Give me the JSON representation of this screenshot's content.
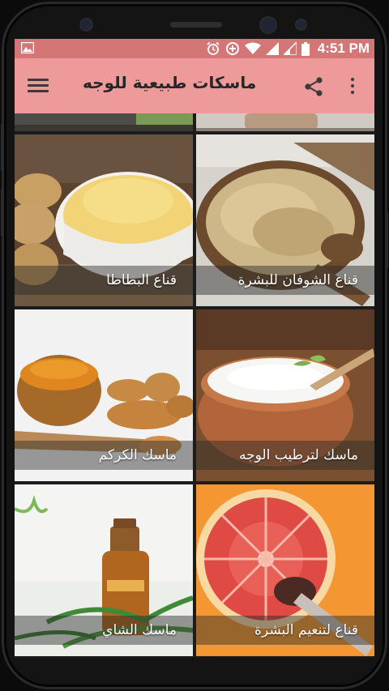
{
  "status_bar": {
    "time": "4:51 PM",
    "icons": [
      "image-icon",
      "alarm-icon",
      "data-saver-icon",
      "wifi-icon",
      "signal-icon",
      "signal-icon",
      "battery-icon"
    ]
  },
  "app_bar": {
    "title": "ماسكات طبيعية للوجه",
    "icons": [
      "menu-icon",
      "share-icon",
      "more-vert-icon"
    ]
  },
  "grid": {
    "cards": [
      {
        "label": "قناع البطاطا"
      },
      {
        "label": "قناع الشوفان للبشرة"
      },
      {
        "label": "ماسك الكركم"
      },
      {
        "label": "ماسك لترطيب الوجه"
      },
      {
        "label": "ماسك الشاي"
      },
      {
        "label": "قناع لتنعيم البشرة"
      }
    ]
  },
  "colors": {
    "status_bar": "#d47676",
    "app_bar": "#ee9a9a"
  }
}
